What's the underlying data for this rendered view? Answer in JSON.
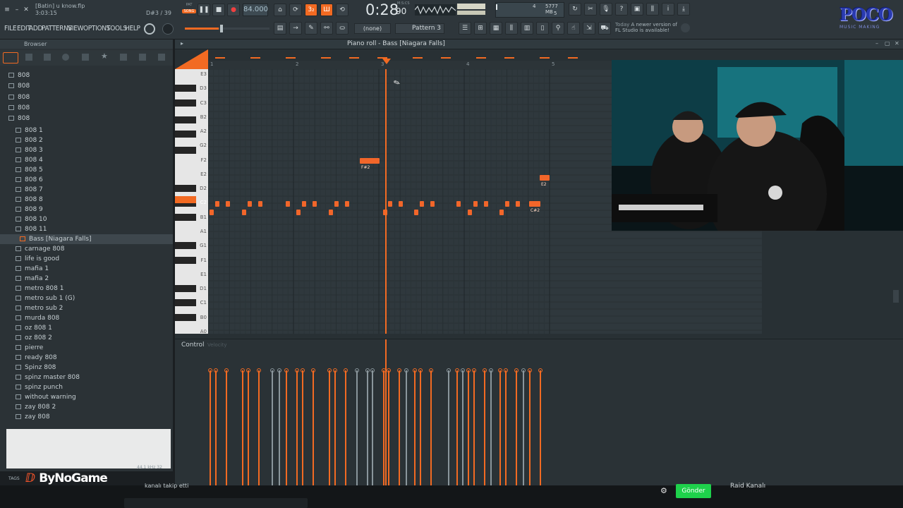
{
  "title": {
    "file": "[Batin] u know.flp",
    "time": "3:03:15",
    "hint": "D#3 / 39"
  },
  "menu": [
    "FILE",
    "EDIT",
    "ADD",
    "PATTERNS",
    "VIEW",
    "OPTIONS",
    "TOOLS",
    "HELP"
  ],
  "transport": {
    "song_label": "SONG",
    "pat_label": "PAT",
    "tempo": "84.000",
    "time_display": "0:28",
    "time_sub": "90",
    "time_unit": "M:S:CS",
    "cpu_a": "4",
    "ram": "5777 MB",
    "cpu_b": "5"
  },
  "toolbar": {
    "none_label": "(none)",
    "pattern_label": "Pattern 3",
    "news_today": "Today",
    "news_text_1": "A newer version of",
    "news_text_2": "FL Studio is available!"
  },
  "browser": {
    "title": "Browser",
    "folders": [
      "808",
      "808",
      "808",
      "808",
      "808"
    ],
    "items": [
      "808 1",
      "808 2",
      "808 3",
      "808 4",
      "808 5",
      "808 6",
      "808 7",
      "808 8",
      "808 9",
      "808 10",
      "808 11",
      "Bass [Niagara Falls]",
      "carnage 808",
      "life is good",
      "mafia 1",
      "mafia 2",
      "metro 808 1",
      "metro sub 1 (G)",
      "metro sub 2",
      "murda 808",
      "oz 808 1",
      "oz 808 2",
      "pierre",
      "ready 808",
      "Spinz 808",
      "spinz master 808",
      "spinz punch",
      "without warning",
      "zay 808 2",
      "zay 808"
    ],
    "selected_index": 11,
    "tags_label": "TAGS",
    "footer_info": "44.1 kHz 32"
  },
  "pianoroll": {
    "title": "Piano roll - Bass [Niagara Falls]",
    "bars": [
      "1",
      "2",
      "3",
      "4",
      "5"
    ],
    "key_labels": [
      "E3",
      "D3",
      "C3",
      "B2",
      "A2",
      "G2",
      "F2",
      "E2",
      "D2",
      "C2",
      "B1",
      "A1",
      "G1",
      "F1",
      "E1",
      "D1",
      "C1",
      "B0",
      "A0"
    ],
    "note_labels": {
      "fs2": "F#2",
      "e2": "E2",
      "cs2": "C#2"
    },
    "control_label": "Control",
    "control_param": "Velocity"
  },
  "branding": {
    "logo_text": "POCO",
    "logo_sub": "MUSIC MAKING",
    "watermark": "ByNoGame"
  },
  "chat": {
    "message": "kanalı takip etti",
    "send": "Gönder",
    "raid": "Raid Kanalı"
  },
  "colors": {
    "accent": "#f26a22",
    "grid": "#2f383d",
    "send_green": "#1ed14b"
  }
}
